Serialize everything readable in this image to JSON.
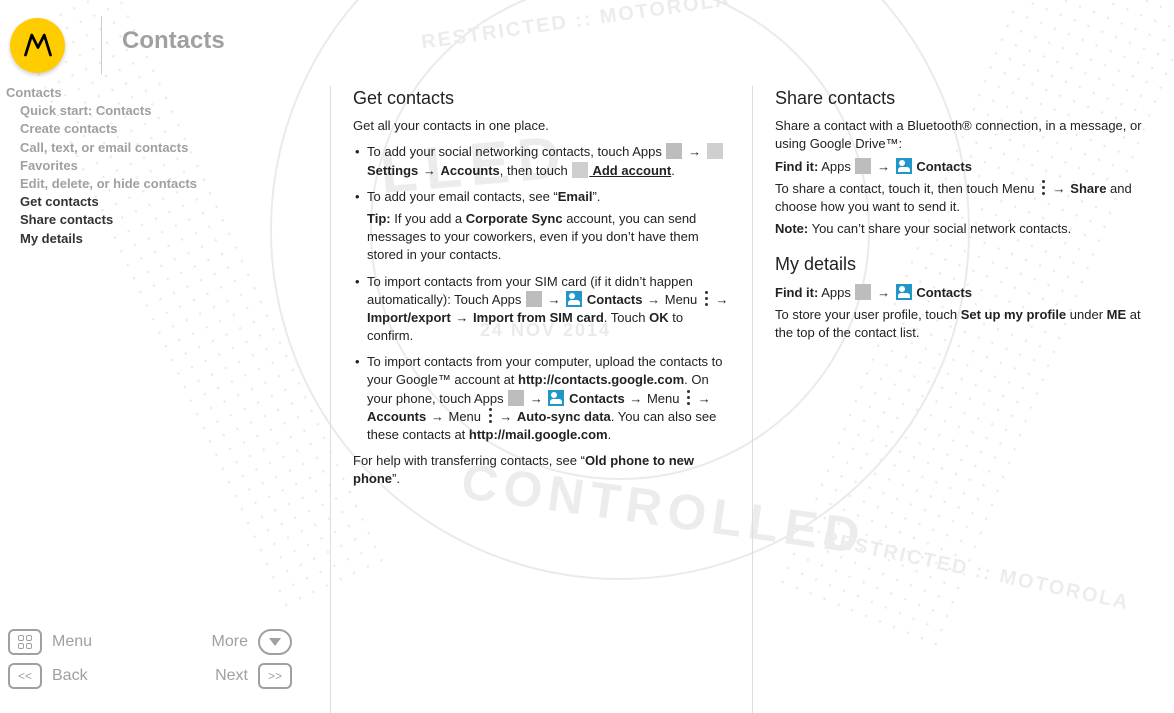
{
  "page_title": "Contacts",
  "toc": {
    "root": "Contacts",
    "items": [
      "Quick start: Contacts",
      "Create contacts",
      "Call, text, or email contacts",
      "Favorites",
      "Edit, delete, or hide contacts",
      "Get contacts",
      "Share contacts",
      "My details"
    ],
    "active_indices": [
      5,
      6,
      7
    ]
  },
  "nav": {
    "menu": "Menu",
    "more": "More",
    "back": "Back",
    "next": "Next"
  },
  "col1": {
    "heading": "Get contacts",
    "intro": "Get all your contacts in one place.",
    "b1_a": "To add your social networking contacts, touch Apps ",
    "b1_b": " Settings",
    "b1_c": "Accounts",
    "b1_d": ", then touch ",
    "b1_e": " Add account",
    "b2_a": "To add your email contacts, see “",
    "b2_b": "Email",
    "b2_c": "”.",
    "b2_tip_label": "Tip:",
    "b2_tip": " If you add a ",
    "b2_tip_b": "Corporate Sync",
    "b2_tip_c": " account, you can send messages to your coworkers, even if you don’t have them stored in your contacts.",
    "b3_a": "To import contacts from your SIM card (if it didn’t happen automatically): Touch Apps ",
    "b3_b": " Contacts",
    "b3_c": " Menu ",
    "b3_d": "Import/export",
    "b3_e": "Import from SIM card",
    "b3_f": ". Touch ",
    "b3_g": "OK",
    "b3_h": " to confirm.",
    "b4_a": "To import contacts from your computer, upload the contacts to your Google™ account at ",
    "b4_url1": "http://contacts.google.com",
    "b4_b": ". On your phone, touch Apps ",
    "b4_c": " Contacts",
    "b4_d": " Menu ",
    "b4_e": "Accounts",
    "b4_f": " Menu ",
    "b4_g": "Auto-sync data",
    "b4_h": ". You can also see these contacts at ",
    "b4_url2": "http://mail.google.com",
    "outro_a": "For help with transferring contacts, see “",
    "outro_b": "Old phone to new phone",
    "outro_c": "”."
  },
  "col2": {
    "heading1": "Share contacts",
    "p1": "Share a contact with a Bluetooth® connection, in a message, or using Google Drive™:",
    "findit1_a": "Find it:",
    "findit1_b": " Apps ",
    "findit1_c": " Contacts",
    "p2_a": "To share a contact, touch it, then touch Menu ",
    "p2_b": "Share",
    "p2_c": " and choose how you want to send it.",
    "note_label": "Note:",
    "note_text": " You can’t share your social network contacts.",
    "heading2": "My details",
    "findit2_a": "Find it:",
    "findit2_b": " Apps ",
    "findit2_c": " Contacts",
    "p3_a": "To store your user profile, touch ",
    "p3_b": "Set up my profile",
    "p3_c": " under ",
    "p3_d": "ME",
    "p3_e": " at the top of the contact list."
  },
  "watermark": {
    "line1": "RESTRICTED :: MOTOROLA",
    "line2": "LLED",
    "line3": "CONTROLLED",
    "line4": "RESTRICTED :: MOTOROLA",
    "date": "24 NOV 2014"
  }
}
